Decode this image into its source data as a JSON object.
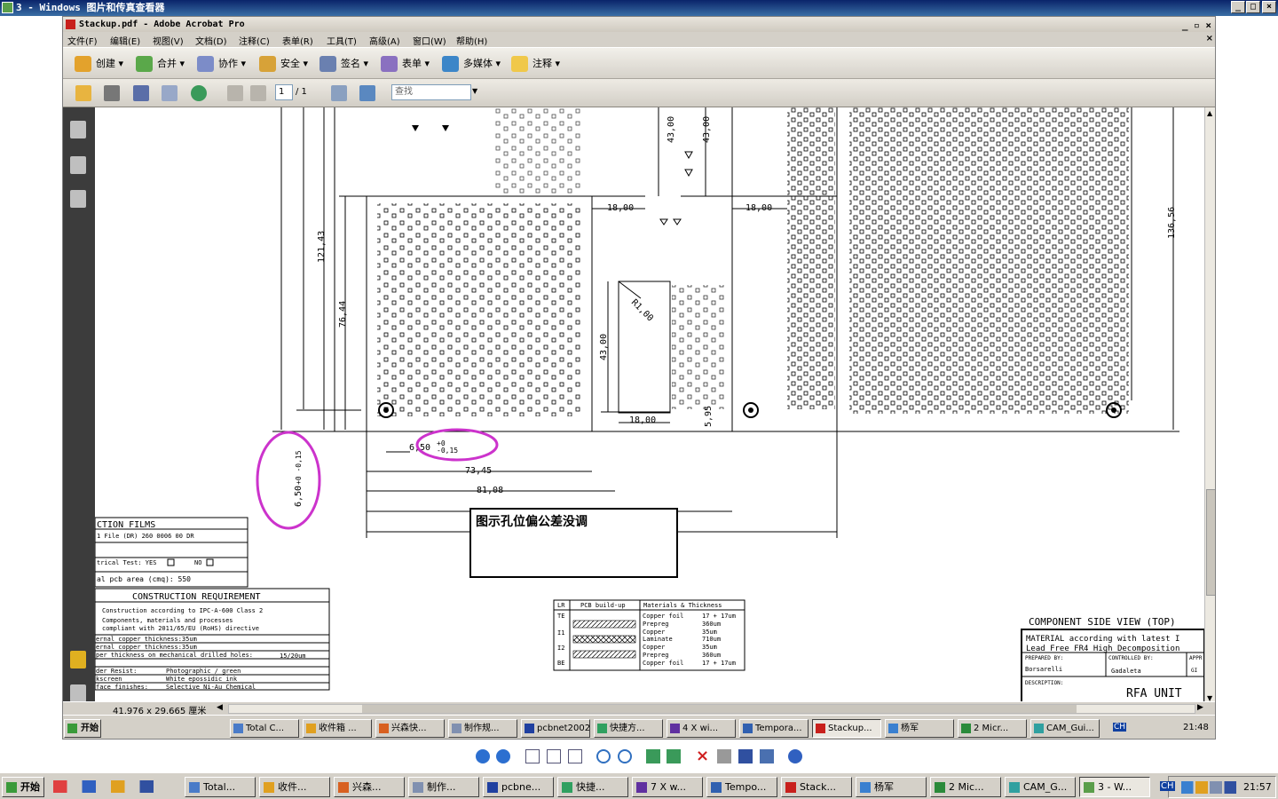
{
  "viewer": {
    "title": "3 - Windows 图片和传真查看器",
    "min_label": "_",
    "max_label": "□",
    "close_label": "×"
  },
  "acrobat": {
    "title": "Stackup.pdf - Adobe Acrobat Pro",
    "menu": [
      "文件(F)",
      "编辑(E)",
      "视图(V)",
      "文档(D)",
      "注释(C)",
      "表单(R)",
      "工具(T)",
      "高级(A)",
      "窗口(W)",
      "帮助(H)"
    ],
    "toolbar": [
      "创建",
      "合并",
      "协作",
      "安全",
      "签名",
      "表单",
      "多媒体",
      "注释"
    ],
    "page_current": "1",
    "page_total": "/ 1",
    "search_placeholder": "查找",
    "status_size": "41.976 x 29.665 厘米"
  },
  "drawing": {
    "dims": {
      "d_121_43": "121,43",
      "d_76_44": "76,44",
      "d_43_00_a": "43,00",
      "d_43_00_b": "43,00",
      "d_18_00_a": "18,00",
      "d_18_00_b": "18,00",
      "d_18_00_c": "18,00",
      "d_43_00_c": "43,00",
      "d_r1_00": "R1,00",
      "d_5_95": "5,95",
      "d_136_56": "136,56",
      "d_6_50": "6,50",
      "d_plus0": "+0",
      "d_minus015": "-0,15",
      "d_6_50_v": "6,50",
      "d_tol_v": "+0 -0,15",
      "d_73_45": "73,45",
      "d_81_08": "81,08"
    },
    "annotation_text": "图示孔位偏公差没调",
    "films": {
      "title": "CTION FILMS",
      "row1": "1 File      (DR)  260 0006 00 DR",
      "row2": "trical Test: YES",
      "row2_no": "NO",
      "row3": "al pcb area (cmq): 550"
    },
    "construction": {
      "title": "CONSTRUCTION REQUIREMENT",
      "l1": "Construction according to IPC-A-600 Class 2",
      "l2": "Components, materials and processes",
      "l3": "compliant with 2011/65/EU (RoHS) directive",
      "l4": "ernal copper thickness:35um",
      "l5": "ernal copper thickness:35um",
      "l6": "per thickness on mechanical drilled holes:",
      "l6v": "15/20um",
      "l7": "der Resist:",
      "l7v": "Photographic / green",
      "l8": "kscreen",
      "l8v": "White epossidic ink",
      "l9": "face finishes:",
      "l9v": "Selective Ni-Au Chemical"
    },
    "buildup": {
      "h1": "LR",
      "h2": "PCB build-up",
      "h3": "Materials & Thickness",
      "layers": [
        "TE",
        "I1",
        "I2",
        "BE"
      ],
      "materials": [
        "Copper foil",
        "Prepreg",
        "Copper",
        "Laminate",
        "Copper",
        "Prepreg",
        "Copper foil"
      ],
      "thickness": [
        "17 + 17um",
        "360um",
        "35um",
        "710um",
        "35um",
        "360um",
        "17 + 17um"
      ]
    },
    "titleblock": {
      "view": "COMPONENT SIDE VIEW (TOP)",
      "material1": "MATERIAL according with latest I",
      "material2": "Lead Free FR4 High Decomposition",
      "prepared_label": "PREPARED BY:",
      "prepared": "Borsarelli",
      "controlled_label": "CONTROLLED BY:",
      "controlled": "Gadaleta",
      "appr": "APPR",
      "gi": "GI",
      "desc_label": "DESCRIPTION:",
      "desc": "RFA UNIT"
    }
  },
  "inner_taskbar": {
    "start": "开始",
    "items": [
      "Total C...",
      "收件箱 ...",
      "兴森快...",
      "制作规...",
      "pcbnet2002",
      "快捷方...",
      "4 X wi...",
      "Tempora...",
      "Stackup...",
      "杨军",
      "2 Micr...",
      "CAM_Gui..."
    ],
    "clock": "21:48",
    "ime": "CH"
  },
  "taskbar": {
    "start": "开始",
    "items": [
      "Total...",
      "收件...",
      "兴森...",
      "制作...",
      "pcbne...",
      "快捷...",
      "7 X w...",
      "Tempo...",
      "Stack...",
      "杨军",
      "2 Mic...",
      "CAM_G...",
      "3 - W..."
    ],
    "clock": "21:57",
    "ime": "CH"
  }
}
